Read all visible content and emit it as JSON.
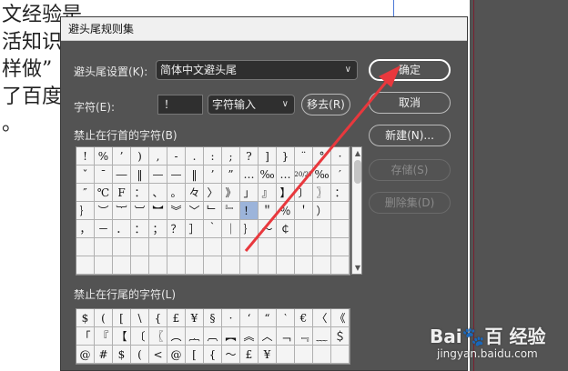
{
  "background_doc": {
    "lines": [
      "文经验是",
      "活知识",
      "样做”",
      "了百度",
      "。"
    ]
  },
  "dialog": {
    "title": "避头尾规则集",
    "settings_label": "避头尾设置(K):",
    "settings_value": "简体中文避头尾",
    "char_label": "字符(E):",
    "char_value": "！",
    "input_mode": "字符输入",
    "remove_button": "移去(R)",
    "ok_button": "确定",
    "cancel_button": "取消",
    "new_button": "新建(N)...",
    "save_button": "存储(S)",
    "delete_button": "删除集(D)",
    "head_label": "禁止在行首的字符(B)",
    "tail_label": "禁止在行尾的字符(L)",
    "head_rows": [
      [
        "!",
        "%",
        "’",
        ")",
        ",",
        "-",
        ".",
        ":",
        ";",
        "?",
        "]",
        "}",
        "¨",
        "°",
        "·"
      ],
      [
        "ˇ",
        "ˉ",
        "―",
        "‖",
        "—",
        "—",
        "‖",
        "’",
        "”",
        "…",
        "‰",
        "…",
        "20/27",
        "‰",
        "′"
      ],
      [
        "″",
        "℃",
        "F",
        "：",
        "、",
        "。",
        "々",
        "〉",
        "》",
        "」",
        "』",
        "】",
        "〕",
        "〗",
        "："
      ],
      [
        "｝",
        "︶",
        "︸",
        "︺",
        "︼",
        "︾",
        "﹀",
        "﹂",
        "﹄",
        "！",
        "＂",
        "％",
        "＇",
        "）",
        ""
      ],
      [
        "，",
        "－",
        "．",
        "：",
        "；",
        "？",
        "］",
        "｀",
        "｜",
        "｝",
        "～",
        "￠",
        "",
        "",
        ""
      ],
      [
        "",
        "",
        "",
        "",
        "",
        "",
        "",
        "",
        "",
        "",
        "",
        "",
        "",
        "",
        ""
      ],
      [
        "",
        "",
        "",
        "",
        "",
        "",
        "",
        "",
        "",
        "",
        "",
        "",
        "",
        "",
        ""
      ]
    ],
    "head_highlight": {
      "row": 3,
      "col": 9
    },
    "tail_rows": [
      [
        "$",
        "(",
        "[",
        "\\",
        "{",
        "£",
        "¥",
        "§",
        "·",
        "‘",
        "“",
        "‵",
        "€",
        "〈",
        "《"
      ],
      [
        "「",
        "『",
        "【",
        "〔",
        "〖",
        "︵",
        "︷",
        "︹",
        "︻",
        "︽",
        "︿",
        "﹁",
        "﹃",
        "﹏",
        "＄"
      ],
      [
        "@",
        "#",
        "$",
        "(",
        "<",
        "@",
        "[",
        "{",
        "～",
        "£",
        "¥",
        "",
        "",
        "",
        ""
      ]
    ]
  },
  "watermark": {
    "main": "Bai🐾百 经验",
    "sub": "jingyan.baidu.com"
  },
  "colors": {
    "dialog_bg": "#535353",
    "highlight": "#9cb4da",
    "annotation_arrow": "#e8383d"
  },
  "icons": {
    "dropdown": "chevron-down-icon",
    "scroll_up": "arrow-up-icon",
    "scroll_down": "arrow-down-icon",
    "annotation": "red-arrow-icon"
  }
}
